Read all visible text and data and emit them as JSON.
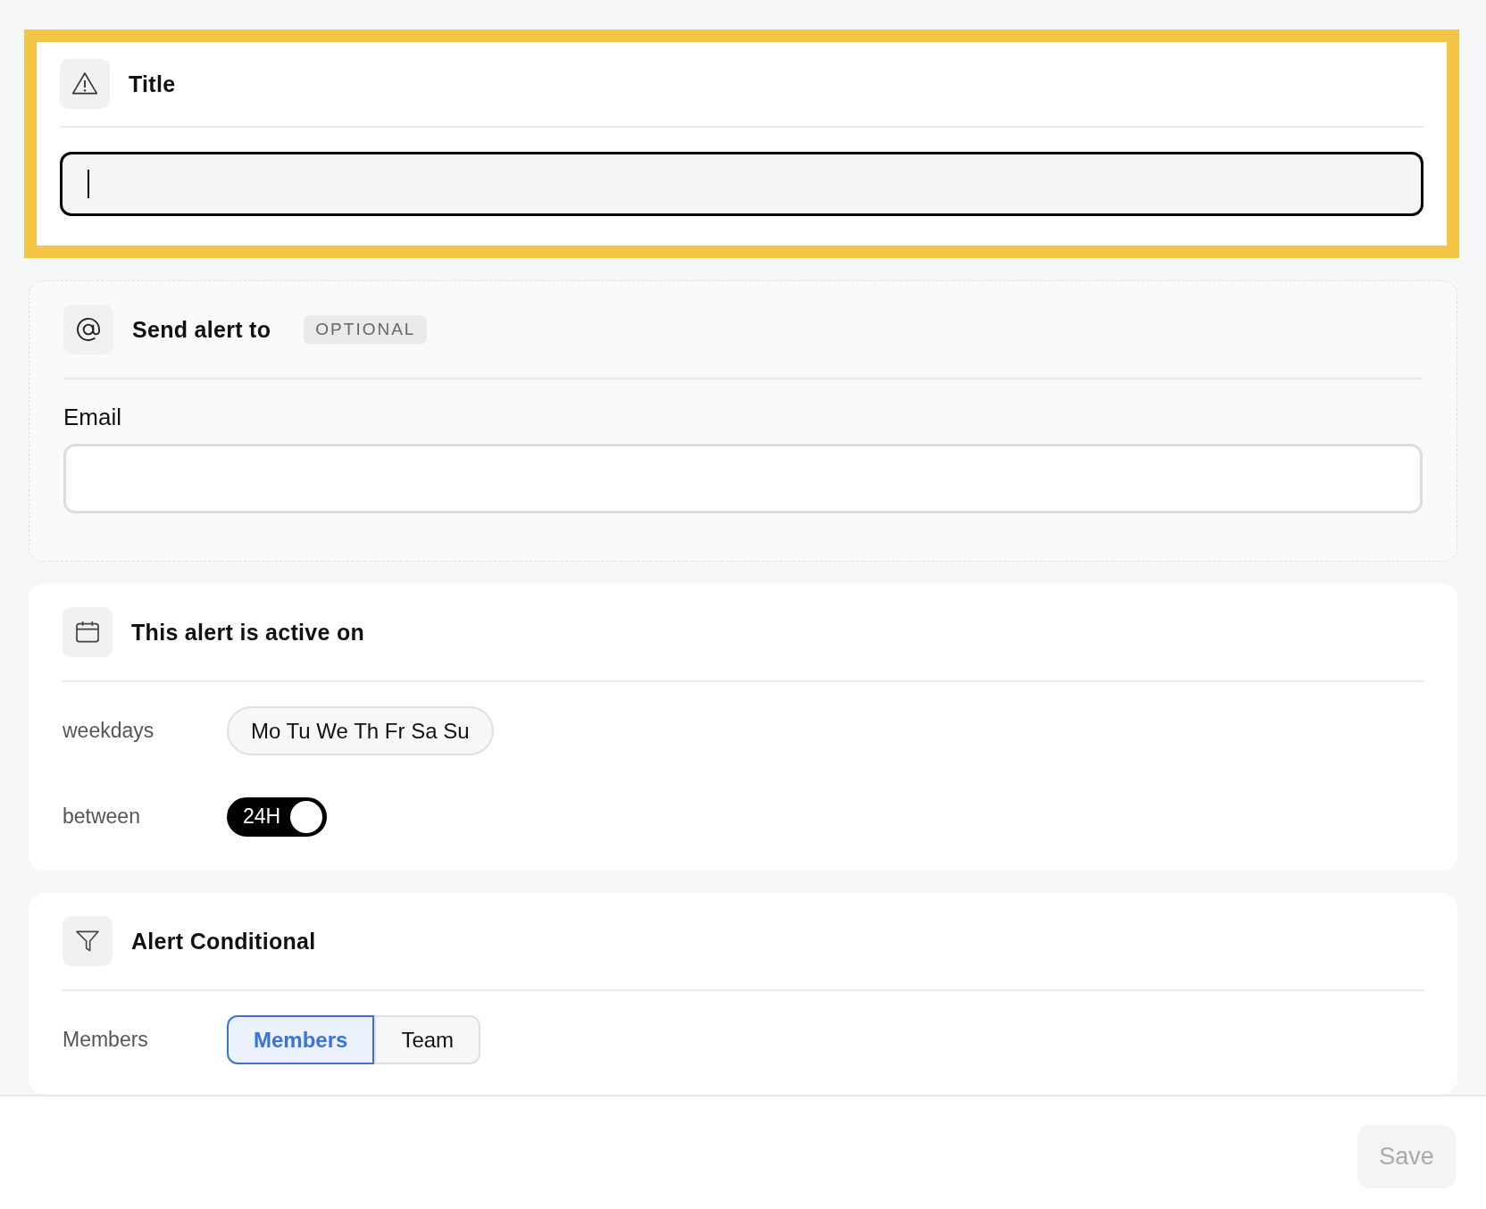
{
  "sections": [
    {
      "kind": "title",
      "title": "Title",
      "highlighted": true,
      "field": {
        "focused": true
      }
    },
    {
      "kind": "recipients",
      "title": "Send alert to",
      "badge": "OPTIONAL",
      "optional": true,
      "field_label": "Email"
    },
    {
      "kind": "schedule",
      "title": "This alert is active on",
      "weekdays_label": "weekdays",
      "weekdays": "Mo Tu We Th Fr Sa Su",
      "between_label": "between",
      "toggle": {
        "label": "24H",
        "on": true
      }
    },
    {
      "kind": "condition",
      "title": "Alert Conditional",
      "row_label": "Members",
      "options": [
        {
          "label": "Members",
          "selected": true
        },
        {
          "label": "Team",
          "selected": false
        }
      ]
    }
  ],
  "save": {
    "label": "Save",
    "disabled": true
  }
}
